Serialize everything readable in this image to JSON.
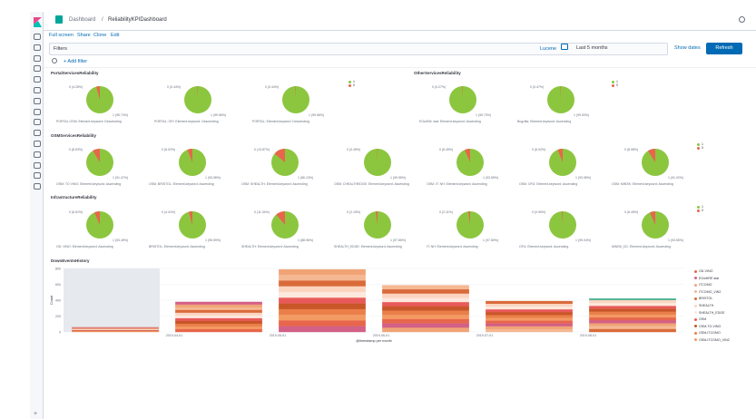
{
  "breadcrumb": {
    "root": "Dashboard",
    "separator": "/",
    "current": "ReliabilityKPIDashboard"
  },
  "menu": {
    "full_screen": "Full screen",
    "share": "Share",
    "clone": "Clone",
    "edit": "Edit"
  },
  "query": {
    "filters_label": "Filters",
    "lucene": "Lucene",
    "date_range": "Last 5 months",
    "show_dates": "Show dates",
    "refresh": "Refresh"
  },
  "filter": {
    "add": "+ Add filter"
  },
  "colors": {
    "green": "#8cc63f",
    "red": "#e7664c",
    "accent": "#006bb4"
  },
  "sections": {
    "portal": "PortalServicesReliability",
    "other": "OtherServicesReliability",
    "osm": "OSMServicesReliability",
    "infra": "InfrastructureReliability"
  },
  "legend": {
    "one": "1",
    "zero": "0"
  },
  "pies": {
    "portal": [
      {
        "top": "0 (4.26%)",
        "bottom": "1 (95.74%)",
        "caption": "PORTAL OSM: Element.keyword: Descending",
        "red_pct": 4.26
      },
      {
        "top": "0 (0.44%)",
        "bottom": "1 (99.56%)",
        "caption": "PORTAL: OFI: Element.keyword: Descending",
        "red_pct": 0.44
      },
      {
        "top": "0 (0.44%)",
        "bottom": "1 (99.56%)",
        "caption": "PORTAL: Element.keyword: Descending",
        "red_pct": 0.44
      }
    ],
    "other": [
      {
        "top": "0 (0.27%)",
        "bottom": "1 (99.73%)",
        "caption": "EGwDW: stat: Element.keyword: Ascending",
        "red_pct": 0.27
      },
      {
        "top": "0 (0.47%)",
        "bottom": "1 (99.53%)",
        "caption": "Bugzilla: Element.keyword: Ascending",
        "red_pct": 0.47
      }
    ],
    "osm": [
      {
        "top": "0 (8.53%)",
        "bottom": "1 (91.47%)",
        "caption": "OSM: TO VINO: Element.keyword: Ascending",
        "red_pct": 8.53
      },
      {
        "top": "0 (6.02%)",
        "bottom": "1 (93.98%)",
        "caption": "OSM: BRISTOL: Element.keyword: Ascending",
        "red_pct": 6.02
      },
      {
        "top": "0 (13.87%)",
        "bottom": "1 (86.13%)",
        "caption": "OSM: SHEALTH: Element.keyword: Ascending",
        "red_pct": 13.87
      },
      {
        "top": "0 (0.45%)",
        "bottom": "1 (99.55%)",
        "caption": "OSM: CHEALTHEDGE: Element.keyword: Ascending",
        "red_pct": 0.45
      },
      {
        "top": "0 (6.45%)",
        "bottom": "1 (93.55%)",
        "caption": "OSM: IT: NH: Element.keyword: Ascending",
        "red_pct": 6.45
      },
      {
        "top": "0 (6.02%)",
        "bottom": "1 (93.98%)",
        "caption": "OSM: OFU: Element.keyword: Ascending",
        "red_pct": 6.02
      },
      {
        "top": "0 (8.98%)",
        "bottom": "1 (91.02%)",
        "caption": "OSM: MINSK: Element.keyword: Ascending",
        "red_pct": 8.98
      }
    ],
    "infra": [
      {
        "top": "0 (6.51%)",
        "bottom": "1 (93.49%)",
        "caption": "OD: VINO: Element.keyword: Ascending",
        "red_pct": 6.51
      },
      {
        "top": "0 (4.41%)",
        "bottom": "1 (95.59%)",
        "caption": "BRISTOL: Element.keyword: Ascending",
        "red_pct": 4.41
      },
      {
        "top": "0 (11.04%)",
        "bottom": "1 (88.96%)",
        "caption": "SHEALTH: Element.keyword: Ascending",
        "red_pct": 11.04
      },
      {
        "top": "0 (2.15%)",
        "bottom": "1 (97.85%)",
        "caption": "SHEALTH_EDGE: Element.keyword: Ascending",
        "red_pct": 2.15
      },
      {
        "top": "0 (2.11%)",
        "bottom": "1 (97.89%)",
        "caption": "IT: NH: Element.keyword: Ascending",
        "red_pct": 2.11
      },
      {
        "top": "0 (0.96%)",
        "bottom": "1 (99.04%)",
        "caption": "OFU: Element.keyword: Ascending",
        "red_pct": 0.96
      },
      {
        "top": "0 (6.45%)",
        "bottom": "1 (93.55%)",
        "caption": "MINSK_DC: Element.keyword: Ascending",
        "red_pct": 6.45
      }
    ]
  },
  "chart_data": {
    "type": "bar",
    "title": "DownEventsHistory",
    "xlabel": "@timestamp per month",
    "ylabel": "Count",
    "ylim": [
      0,
      800
    ],
    "yticks": [
      "800",
      "600",
      "400",
      "200",
      "0"
    ],
    "categories": [
      "2019-04-01",
      "2019-05-01",
      "2019-06-01",
      "2019-07-01",
      "2019-08-01",
      "2019-09-01"
    ],
    "xtick_labels": [
      "2019-04-01",
      "2019-05-01",
      "2019-06-01",
      "2019-07-01",
      "2019-08-01"
    ],
    "totals": [
      60,
      380,
      790,
      590,
      390,
      400
    ],
    "series_names": [
      "OD-VINO",
      "EGwHRE stat",
      "ITCOMO",
      "ITCOMO_VIN2",
      "BRISTOL",
      "SHEALTH",
      "SHEALTH_EDGE",
      "OSM",
      "OSM-TO-VINO",
      "OSM-ITCOMO",
      "OSM-ITCOMO_VIN2"
    ],
    "series_colors": [
      "#e7664c",
      "#d36086",
      "#f0a476",
      "#f5b893",
      "#d96a3a",
      "#fbd5c0",
      "#fce8dc",
      "#e85a5a",
      "#c85628",
      "#ea7f4a",
      "#f39a63"
    ],
    "grid": true
  }
}
